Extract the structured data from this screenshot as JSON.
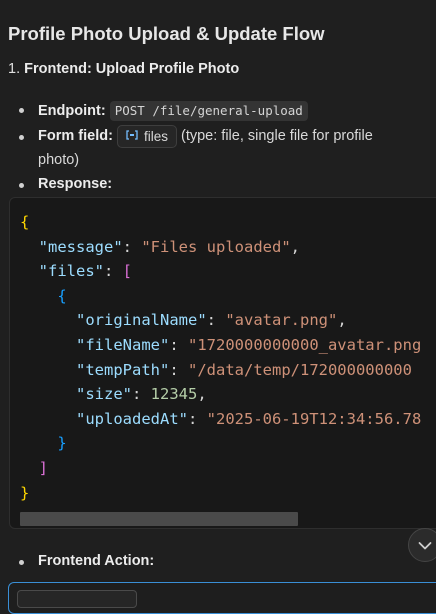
{
  "heading": "Profile Photo Upload & Update Flow",
  "step1": {
    "number": "1.",
    "title": "Frontend: Upload Profile Photo"
  },
  "bullets": {
    "endpoint": {
      "label": "Endpoint:",
      "code": "POST /file/general-upload"
    },
    "form_field": {
      "label": "Form field:",
      "chip_icon": "symbol-field-icon",
      "chip_text": "files",
      "desc_line1": "(type: file, single file for profile",
      "desc_line2": "photo)"
    },
    "response": {
      "label": "Response:"
    },
    "frontend_action": {
      "label": "Frontend Action:"
    }
  },
  "code": {
    "language": "json",
    "lines": [
      "{",
      "  \"message\": \"Files uploaded\",",
      "  \"files\": [",
      "    {",
      "      \"originalName\": \"avatar.png\",",
      "      \"fileName\": \"1720000000000_avatar.png",
      "      \"tempPath\": \"/data/temp/172000000000",
      "      \"size\": 12345,",
      "      \"uploadedAt\": \"2025-06-19T12:34:56.78",
      "    }",
      "  ]",
      "}"
    ]
  },
  "icons": {
    "scroll_down": "chevron-down-icon",
    "field": "symbol-field-icon"
  },
  "colors": {
    "background": "#1f1f1f",
    "code_background": "#181818",
    "json_key": "#9cdcfe",
    "json_string": "#ce9178",
    "json_number": "#b5cea8",
    "bracket_level1": "#ffd700",
    "bracket_level2": "#da70d6",
    "bracket_level3": "#179fff",
    "input_focus_border": "#3a8fd6"
  }
}
